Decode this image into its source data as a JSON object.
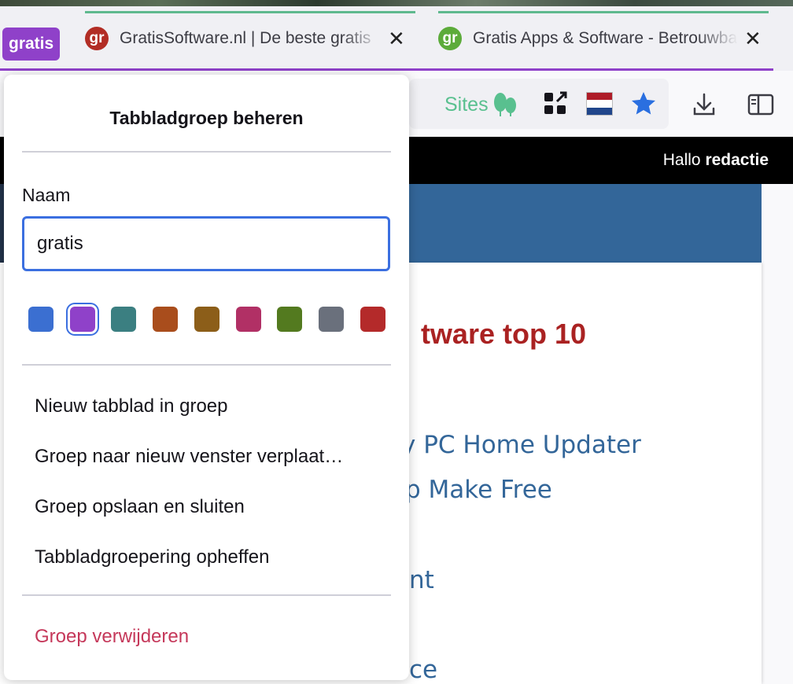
{
  "tab_group": {
    "label": "gratis",
    "color": "#8f41c9"
  },
  "tabs": [
    {
      "favicon_text": "gr",
      "favicon_color": "#b22d25",
      "title": "GratisSoftware.nl | De beste gratis",
      "close_icon": "close-icon"
    },
    {
      "favicon_text": "gr",
      "favicon_color": "#5cab3a",
      "title": "Gratis Apps & Software - Betrouwbaar",
      "close_icon": "close-icon"
    }
  ],
  "toolbar": {
    "sites_label": "Sites",
    "icons": [
      "tree-icon",
      "qr-grid-icon",
      "dutch-flag-icon",
      "star-icon",
      "download-icon",
      "sidebar-icon"
    ],
    "accent": "#59c08f"
  },
  "page": {
    "greeting_prefix": "Hallo ",
    "greeting_user": "redactie",
    "heading": "tware top 10",
    "links": [
      "y PC Home Updater",
      "p Make Free",
      "nt",
      "ce"
    ]
  },
  "popup": {
    "title": "Tabbladgroep beheren",
    "name_label": "Naam",
    "name_value": "gratis",
    "colors": [
      {
        "name": "blue",
        "hex": "#3b6fd1",
        "selected": false
      },
      {
        "name": "purple",
        "hex": "#8f41c9",
        "selected": true
      },
      {
        "name": "cyan",
        "hex": "#3b7f81",
        "selected": false
      },
      {
        "name": "orange",
        "hex": "#a94d1c",
        "selected": false
      },
      {
        "name": "yellow",
        "hex": "#8c5e19",
        "selected": false
      },
      {
        "name": "pink",
        "hex": "#b13065",
        "selected": false
      },
      {
        "name": "green",
        "hex": "#537a1f",
        "selected": false
      },
      {
        "name": "grey",
        "hex": "#6a707c",
        "selected": false
      },
      {
        "name": "red",
        "hex": "#b42a2a",
        "selected": false
      }
    ],
    "actions": [
      "Nieuw tabblad in groep",
      "Groep naar nieuw venster verplaat…",
      "Groep opslaan en sluiten",
      "Tabbladgroepering opheffen"
    ],
    "delete_label": "Groep verwijderen"
  }
}
